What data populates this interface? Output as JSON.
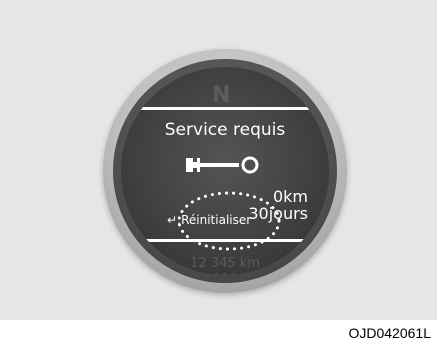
{
  "display": {
    "title": "Service requis",
    "distance": "0km",
    "days": "30jours",
    "reset_label": "↵:Réinitialiser",
    "ghost_top": "N",
    "ghost_odometer": "12 345 km",
    "ghost_trip": "000"
  },
  "figure_code": "OJD042061L",
  "colors": {
    "background": "#e6e6e6",
    "screen": "#3f3f3f",
    "text": "#ffffff"
  },
  "icons": {
    "service": "wrench-icon",
    "reset": "enter-arrow-icon"
  }
}
